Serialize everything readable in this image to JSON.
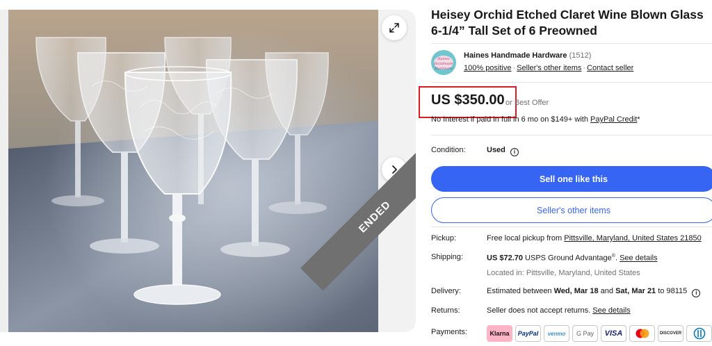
{
  "listing": {
    "title": "Heisey Orchid Etched Claret Wine Blown Glass 6-1/4” Tall Set of 6 Preowned",
    "status_banner": "ENDED"
  },
  "gallery": {
    "expand_icon": "expand-icon",
    "next_icon": "chevron-right-icon"
  },
  "seller": {
    "name": "Haines Handmade Hardware",
    "feedback_count": "(1512)",
    "positive": "100% positive",
    "other_items_link": "Seller's other items",
    "contact_link": "Contact seller",
    "avatar_text": "Haines Handmade Hardware"
  },
  "price": {
    "amount": "US $350.00",
    "best_offer": "or Best Offer",
    "credit_text": "No Interest if paid in full in 6 mo on $149+ with ",
    "credit_link": "PayPal Credit",
    "credit_suffix": "*",
    "highlight_color": "#e0191f"
  },
  "condition": {
    "label": "Condition:",
    "value": "Used"
  },
  "actions": {
    "primary": "Sell one like this",
    "secondary": "Seller's other items",
    "accent_color": "#3665f3"
  },
  "details": {
    "pickup": {
      "label": "Pickup:",
      "prefix": "Free local pickup from ",
      "location_link": "Pittsville, Maryland, United States 21850"
    },
    "shipping": {
      "label": "Shipping:",
      "amount": "US $72.70",
      "service": " USPS Ground Advantage",
      "reg": "®",
      "dot": ". ",
      "details_link": "See details",
      "located": "Located in: Pittsville, Maryland, United States"
    },
    "delivery": {
      "label": "Delivery:",
      "prefix": "Estimated between ",
      "start": "Wed, Mar 18",
      "and": " and ",
      "end": "Sat, Mar 21",
      "suffix": " to 98115"
    },
    "returns": {
      "label": "Returns:",
      "text": "Seller does not accept returns. ",
      "details_link": "See details"
    },
    "payments": {
      "label": "Payments:",
      "methods": [
        "Klarna",
        "PayPal",
        "venmo",
        "G Pay",
        "VISA",
        "",
        "DISCOVER",
        ""
      ]
    }
  }
}
